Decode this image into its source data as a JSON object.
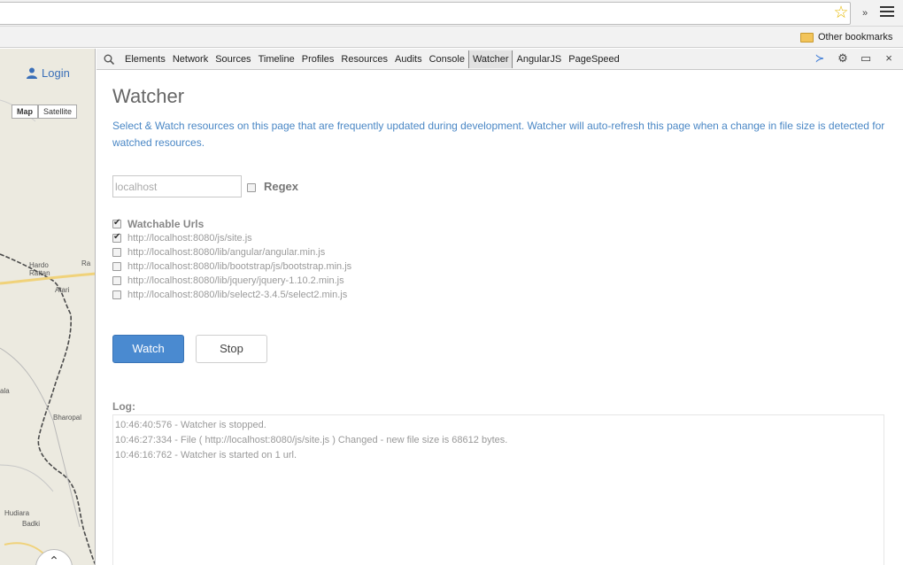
{
  "browser": {
    "bookmarks": {
      "other_label": "Other bookmarks"
    }
  },
  "map": {
    "login_label": "Login",
    "map_type": [
      "Map",
      "Satellite"
    ],
    "labels": [
      {
        "text": "Hardo\nRattan"
      },
      {
        "text": "Atari"
      },
      {
        "text": "Ra"
      },
      {
        "text": "Bharopal"
      },
      {
        "text": "Hudiara"
      },
      {
        "text": "Badki"
      },
      {
        "text": "ala"
      }
    ]
  },
  "devtools": {
    "tabs": [
      "Elements",
      "Network",
      "Sources",
      "Timeline",
      "Profiles",
      "Resources",
      "Audits",
      "Console",
      "Watcher",
      "AngularJS",
      "PageSpeed"
    ],
    "selected_tab": "Watcher"
  },
  "watcher": {
    "title": "Watcher",
    "description": "Select & Watch resources on this page that are frequently updated during development. Watcher will auto-refresh this page when a change in file size is detected for watched resources.",
    "filter": {
      "value": "localhost",
      "regex_label": "Regex",
      "regex_checked": false
    },
    "urls_header": "Watchable Urls",
    "urls_header_checked": true,
    "urls": [
      {
        "url": "http://localhost:8080/js/site.js",
        "checked": true
      },
      {
        "url": "http://localhost:8080/lib/angular/angular.min.js",
        "checked": false
      },
      {
        "url": "http://localhost:8080/lib/bootstrap/js/bootstrap.min.js",
        "checked": false
      },
      {
        "url": "http://localhost:8080/lib/jquery/jquery-1.10.2.min.js",
        "checked": false
      },
      {
        "url": "http://localhost:8080/lib/select2-3.4.5/select2.min.js",
        "checked": false
      }
    ],
    "watch_label": "Watch",
    "stop_label": "Stop",
    "log_label": "Log:",
    "log": [
      "10:46:40:576 - Watcher is stopped.",
      "10:46:27:334 - File ( http://localhost:8080/js/site.js ) Changed - new file size is 68612 bytes.",
      "10:46:16:762 - Watcher is started on 1 url."
    ]
  }
}
